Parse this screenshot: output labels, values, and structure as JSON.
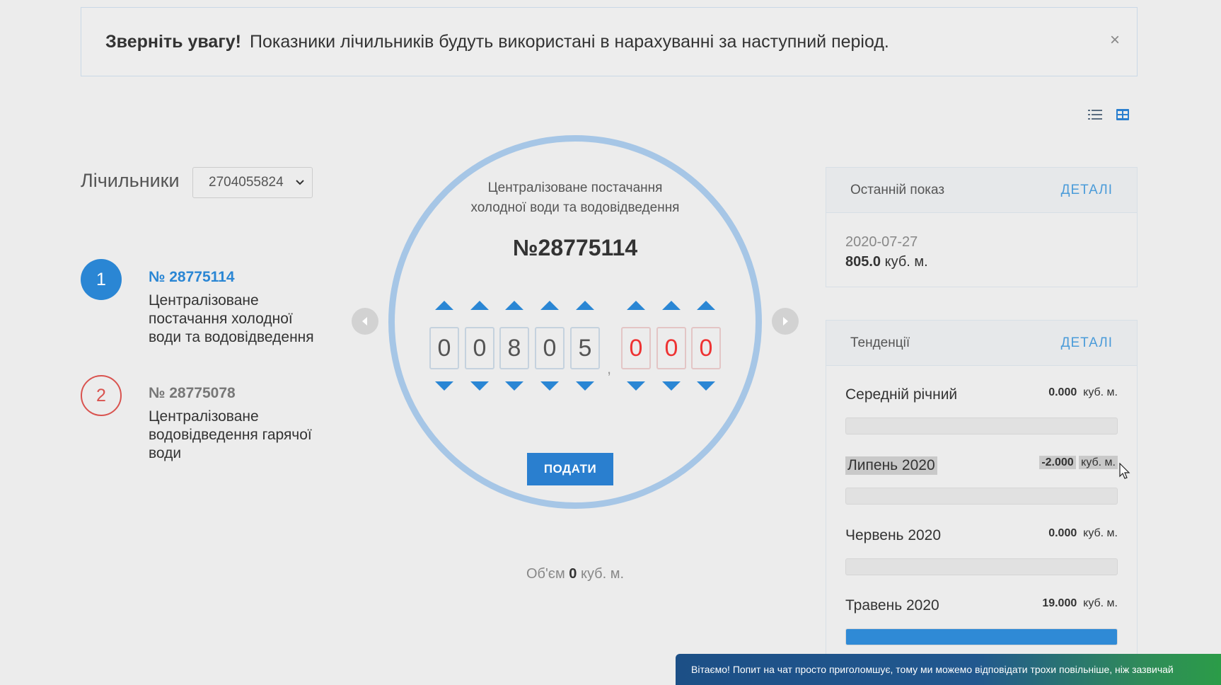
{
  "alert": {
    "bold": "Зверніть увагу!",
    "text": "Показники лічильників будуть використані в нарахуванні за наступний період.",
    "close_symbol": "×"
  },
  "view_toggles": [
    {
      "icon": "list-view-icon",
      "active": false
    },
    {
      "icon": "grid-view-icon",
      "active": true
    }
  ],
  "sidebar": {
    "label": "Лічильники",
    "select_value": "2704055824",
    "meters": [
      {
        "index": "1",
        "title": "№ 28775114",
        "description": "Централізоване постачання холодної води та водовідведення",
        "active": true
      },
      {
        "index": "2",
        "title": "№ 28775078",
        "description": "Централізоване водовідведення гарячої води",
        "active": false
      }
    ]
  },
  "dial": {
    "subtitle_line1": "Централізоване постачання",
    "subtitle_line2": "холодної води та водовідведення",
    "number": "№28775114",
    "integer_digits": [
      "0",
      "0",
      "8",
      "0",
      "5"
    ],
    "fraction_digits": [
      "0",
      "0",
      "0"
    ],
    "separator": ",",
    "volume_prefix": "Об'єм",
    "volume_value": "0",
    "volume_unit": "куб. м.",
    "submit_label": "ПОДАТИ"
  },
  "last_reading": {
    "title": "Останній показ",
    "details": "ДЕТАЛІ",
    "date": "2020-07-27",
    "value": "805.0",
    "unit": "куб. м."
  },
  "trends": {
    "title": "Тенденції",
    "details": "ДЕТАЛІ",
    "rows": [
      {
        "label": "Середній річний",
        "value": "0.000",
        "unit": "куб. м.",
        "fill": 0
      },
      {
        "label": "Липень 2020",
        "value": "-2.000",
        "unit": "куб. м.",
        "fill": 0
      },
      {
        "label": "Червень 2020",
        "value": "0.000",
        "unit": "куб. м.",
        "fill": 0
      },
      {
        "label": "Травень 2020",
        "value": "19.000",
        "unit": "куб. м.",
        "fill": 1
      }
    ]
  },
  "chat": {
    "text": "Вітаємо! Попит на чат просто приголомшує, тому ми можемо відповідати трохи повільніше, ніж зазвичай"
  },
  "colors": {
    "accent": "#2a86d4",
    "danger": "#d9534f",
    "dial_ring": "#a6c6e6",
    "fraction_digits": "#ee3333"
  }
}
